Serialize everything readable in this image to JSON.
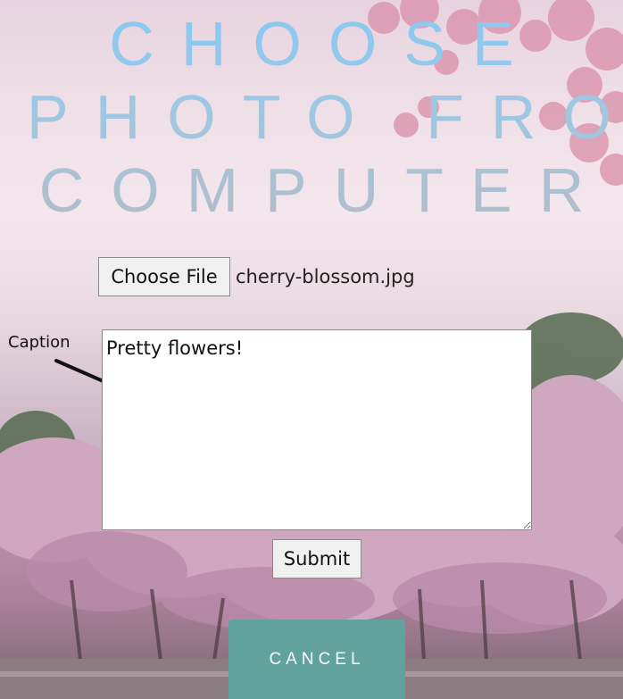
{
  "title": {
    "line1": "CHOOSE",
    "line2": "PHOTO FROM",
    "line3": "COMPUTER"
  },
  "file_picker": {
    "button_label": "Choose File",
    "file_name": "cherry-blossom.jpg"
  },
  "caption": {
    "label": "Caption",
    "value": "Pretty flowers!"
  },
  "submit_label": "Submit",
  "cancel_label": "CANCEL",
  "colors": {
    "title_top": "#86c9f3",
    "title_bottom": "#b3bcc6",
    "cancel_button": "#62a29e"
  },
  "icons": {
    "arrow": "arrow-down-right-icon"
  }
}
